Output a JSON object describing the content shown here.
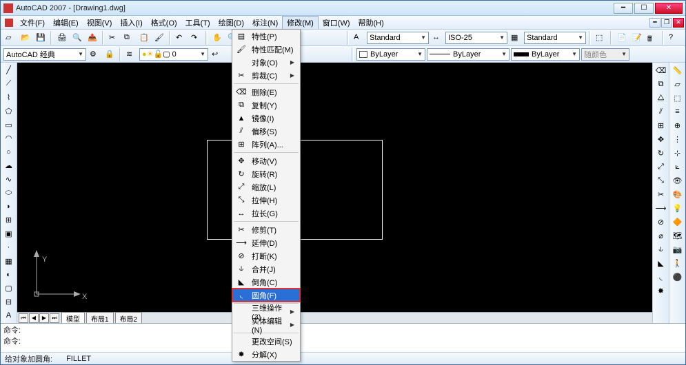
{
  "title": "AutoCAD 2007 - [Drawing1.dwg]",
  "menus": [
    "文件(F)",
    "编辑(E)",
    "视图(V)",
    "插入(I)",
    "格式(O)",
    "工具(T)",
    "绘图(D)",
    "标注(N)",
    "修改(M)",
    "窗口(W)",
    "帮助(H)"
  ],
  "open_menu_index": 8,
  "style_combo_1": "Standard",
  "style_combo_2": "ISO-25",
  "style_combo_3": "Standard",
  "workspace": "AutoCAD 经典",
  "layer_current": "0",
  "bylayer_color": "ByLayer",
  "bylayer_ltype": "ByLayer",
  "bylayer_lweight": "ByLayer",
  "color_combo": "随颜色",
  "tabs": {
    "model": "模型",
    "layout1": "布局1",
    "layout2": "布局2"
  },
  "cmd_prompt": "命令:",
  "status_hint": "给对象加圆角:",
  "status_cmd": "FILLET",
  "ucs": {
    "x": "X",
    "y": "Y"
  },
  "modify_menu": [
    {
      "icon": "props",
      "label": "特性(P)"
    },
    {
      "icon": "match",
      "label": "特性匹配(M)"
    },
    {
      "icon": "",
      "label": "对象(O)",
      "sub": true
    },
    {
      "icon": "clip",
      "label": "剪裁(C)",
      "sub": true
    },
    {
      "sep": true
    },
    {
      "icon": "erase",
      "label": "删除(E)"
    },
    {
      "icon": "copy",
      "label": "复制(Y)"
    },
    {
      "icon": "mirror",
      "label": "镜像(I)"
    },
    {
      "icon": "offset",
      "label": "偏移(S)"
    },
    {
      "icon": "array",
      "label": "阵列(A)..."
    },
    {
      "sep": true
    },
    {
      "icon": "move",
      "label": "移动(V)"
    },
    {
      "icon": "rotate",
      "label": "旋转(R)"
    },
    {
      "icon": "scale",
      "label": "缩放(L)"
    },
    {
      "icon": "stretch",
      "label": "拉伸(H)"
    },
    {
      "icon": "lengthen",
      "label": "拉长(G)"
    },
    {
      "sep": true
    },
    {
      "icon": "trim",
      "label": "修剪(T)"
    },
    {
      "icon": "extend",
      "label": "延伸(D)"
    },
    {
      "icon": "break",
      "label": "打断(K)"
    },
    {
      "icon": "join",
      "label": "合并(J)"
    },
    {
      "icon": "chamfer",
      "label": "倒角(C)"
    },
    {
      "icon": "fillet",
      "label": "圆角(F)",
      "hl": true
    },
    {
      "sep": true
    },
    {
      "icon": "",
      "label": "三维操作(3)",
      "sub": true
    },
    {
      "icon": "",
      "label": "实体编辑(N)",
      "sub": true
    },
    {
      "sep": true
    },
    {
      "icon": "",
      "label": "更改空间(S)"
    },
    {
      "icon": "explode",
      "label": "分解(X)"
    }
  ]
}
